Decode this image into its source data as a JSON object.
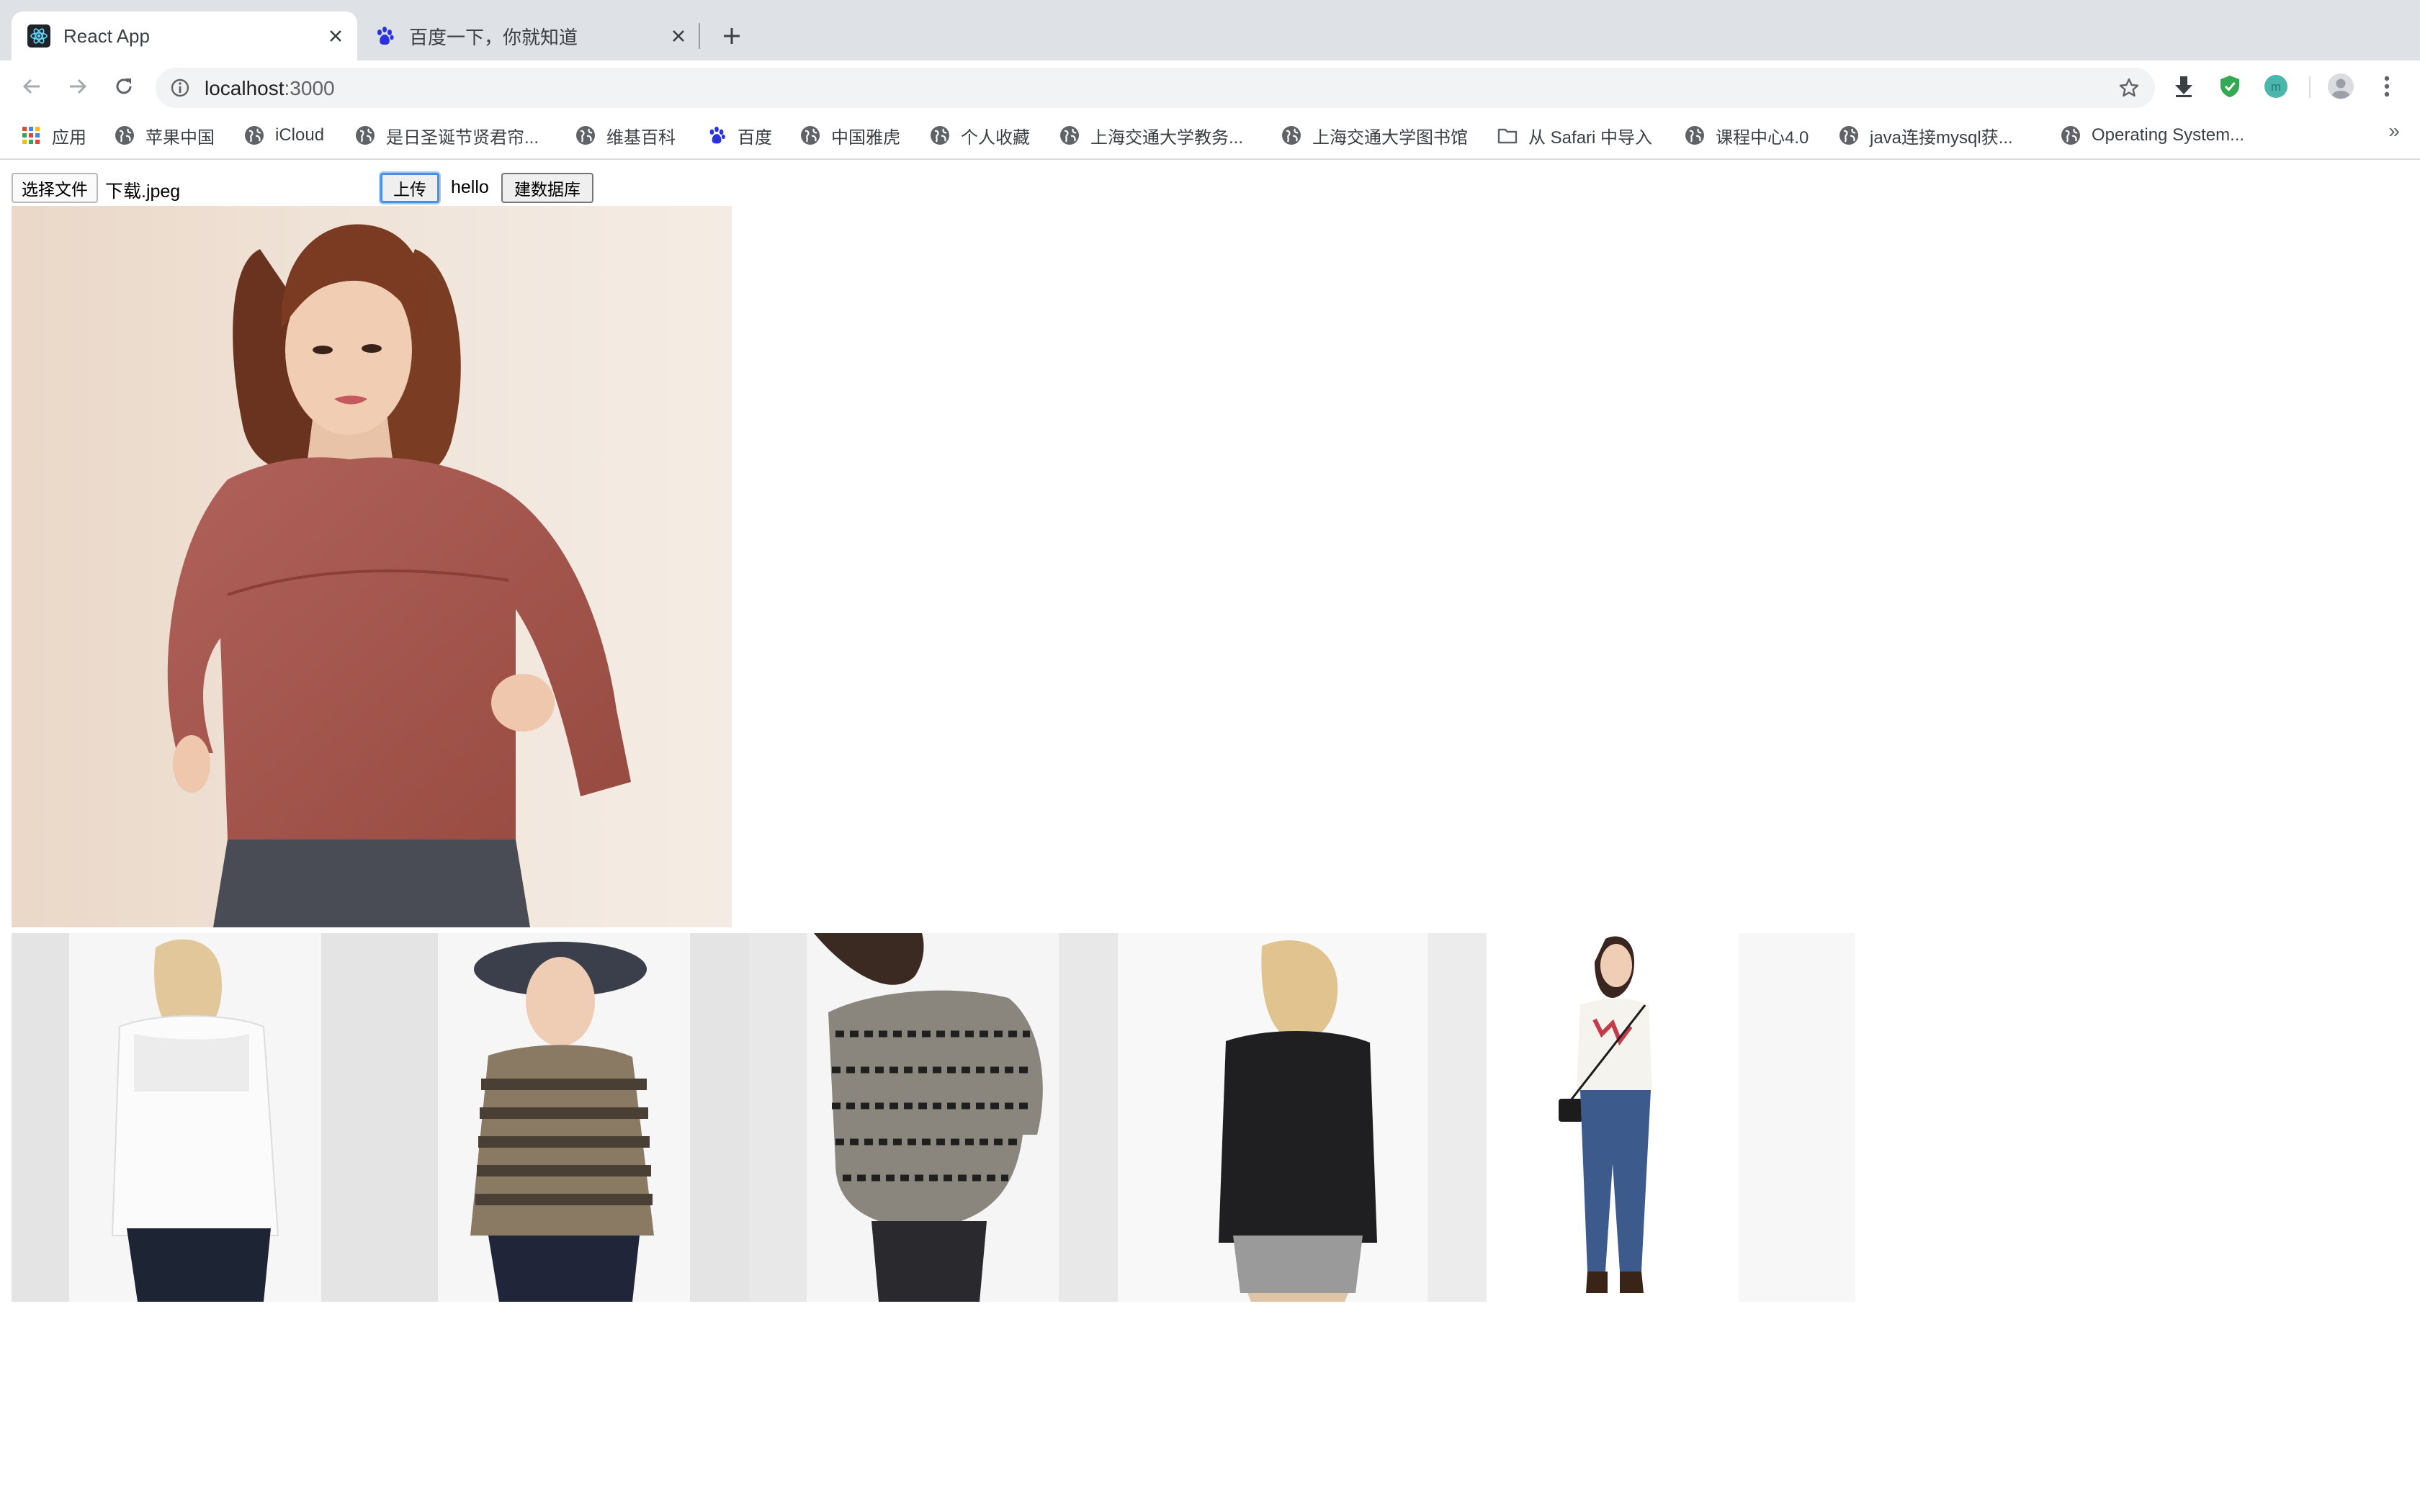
{
  "browser": {
    "tabs": [
      {
        "title": "React App",
        "icon": "react-icon",
        "active": true
      },
      {
        "title": "百度一下，你就知道",
        "icon": "baidu-paw-icon",
        "active": false
      }
    ],
    "address": {
      "host": "localhost",
      "port": ":3000"
    },
    "bookmarks": [
      {
        "label": "应用",
        "icon": "apps-grid-icon"
      },
      {
        "label": "苹果中国",
        "icon": "globe-icon"
      },
      {
        "label": "iCloud",
        "icon": "globe-icon"
      },
      {
        "label": "是日圣诞节贤君帘...",
        "icon": "globe-icon"
      },
      {
        "label": "维基百科",
        "icon": "globe-icon"
      },
      {
        "label": "百度",
        "icon": "baidu-paw-icon"
      },
      {
        "label": "中国雅虎",
        "icon": "globe-icon"
      },
      {
        "label": "个人收藏",
        "icon": "globe-icon"
      },
      {
        "label": "上海交通大学教务...",
        "icon": "globe-icon"
      },
      {
        "label": "上海交通大学图书馆",
        "icon": "globe-icon"
      },
      {
        "label": "从 Safari 中导入",
        "icon": "folder-icon"
      },
      {
        "label": "课程中心4.0",
        "icon": "globe-icon"
      },
      {
        "label": "java连接mysql获...",
        "icon": "globe-icon"
      },
      {
        "label": "Operating System...",
        "icon": "globe-icon"
      }
    ],
    "bookmarks_overflow": "»",
    "extension_avatar_letter": "m"
  },
  "app": {
    "choose_file_label": "选择文件",
    "file_name": "下载.jpeg",
    "upload_label": "上传",
    "hello_text": "hello",
    "build_db_label": "建数据库"
  },
  "colors": {
    "main_sweater": "#a5574f",
    "background_query": "#f1e7de"
  }
}
